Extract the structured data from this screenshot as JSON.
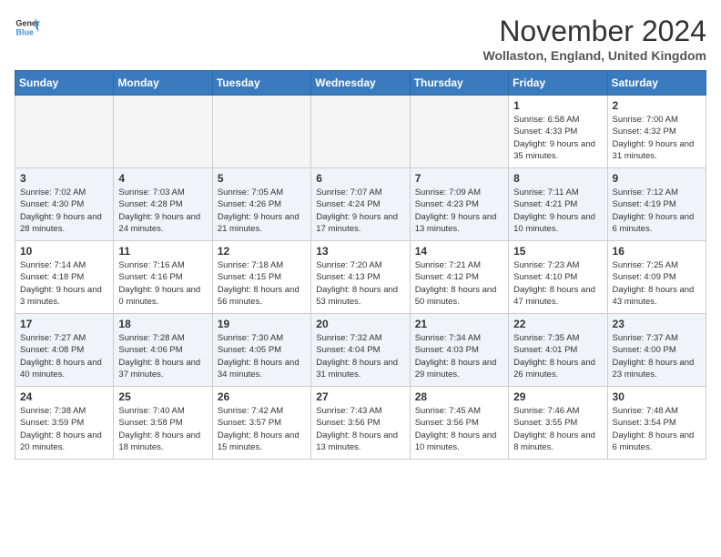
{
  "header": {
    "logo_line1": "General",
    "logo_line2": "Blue",
    "month": "November 2024",
    "location": "Wollaston, England, United Kingdom"
  },
  "weekdays": [
    "Sunday",
    "Monday",
    "Tuesday",
    "Wednesday",
    "Thursday",
    "Friday",
    "Saturday"
  ],
  "weeks": [
    [
      {
        "day": "",
        "info": ""
      },
      {
        "day": "",
        "info": ""
      },
      {
        "day": "",
        "info": ""
      },
      {
        "day": "",
        "info": ""
      },
      {
        "day": "",
        "info": ""
      },
      {
        "day": "1",
        "info": "Sunrise: 6:58 AM\nSunset: 4:33 PM\nDaylight: 9 hours and 35 minutes."
      },
      {
        "day": "2",
        "info": "Sunrise: 7:00 AM\nSunset: 4:32 PM\nDaylight: 9 hours and 31 minutes."
      }
    ],
    [
      {
        "day": "3",
        "info": "Sunrise: 7:02 AM\nSunset: 4:30 PM\nDaylight: 9 hours and 28 minutes."
      },
      {
        "day": "4",
        "info": "Sunrise: 7:03 AM\nSunset: 4:28 PM\nDaylight: 9 hours and 24 minutes."
      },
      {
        "day": "5",
        "info": "Sunrise: 7:05 AM\nSunset: 4:26 PM\nDaylight: 9 hours and 21 minutes."
      },
      {
        "day": "6",
        "info": "Sunrise: 7:07 AM\nSunset: 4:24 PM\nDaylight: 9 hours and 17 minutes."
      },
      {
        "day": "7",
        "info": "Sunrise: 7:09 AM\nSunset: 4:23 PM\nDaylight: 9 hours and 13 minutes."
      },
      {
        "day": "8",
        "info": "Sunrise: 7:11 AM\nSunset: 4:21 PM\nDaylight: 9 hours and 10 minutes."
      },
      {
        "day": "9",
        "info": "Sunrise: 7:12 AM\nSunset: 4:19 PM\nDaylight: 9 hours and 6 minutes."
      }
    ],
    [
      {
        "day": "10",
        "info": "Sunrise: 7:14 AM\nSunset: 4:18 PM\nDaylight: 9 hours and 3 minutes."
      },
      {
        "day": "11",
        "info": "Sunrise: 7:16 AM\nSunset: 4:16 PM\nDaylight: 9 hours and 0 minutes."
      },
      {
        "day": "12",
        "info": "Sunrise: 7:18 AM\nSunset: 4:15 PM\nDaylight: 8 hours and 56 minutes."
      },
      {
        "day": "13",
        "info": "Sunrise: 7:20 AM\nSunset: 4:13 PM\nDaylight: 8 hours and 53 minutes."
      },
      {
        "day": "14",
        "info": "Sunrise: 7:21 AM\nSunset: 4:12 PM\nDaylight: 8 hours and 50 minutes."
      },
      {
        "day": "15",
        "info": "Sunrise: 7:23 AM\nSunset: 4:10 PM\nDaylight: 8 hours and 47 minutes."
      },
      {
        "day": "16",
        "info": "Sunrise: 7:25 AM\nSunset: 4:09 PM\nDaylight: 8 hours and 43 minutes."
      }
    ],
    [
      {
        "day": "17",
        "info": "Sunrise: 7:27 AM\nSunset: 4:08 PM\nDaylight: 8 hours and 40 minutes."
      },
      {
        "day": "18",
        "info": "Sunrise: 7:28 AM\nSunset: 4:06 PM\nDaylight: 8 hours and 37 minutes."
      },
      {
        "day": "19",
        "info": "Sunrise: 7:30 AM\nSunset: 4:05 PM\nDaylight: 8 hours and 34 minutes."
      },
      {
        "day": "20",
        "info": "Sunrise: 7:32 AM\nSunset: 4:04 PM\nDaylight: 8 hours and 31 minutes."
      },
      {
        "day": "21",
        "info": "Sunrise: 7:34 AM\nSunset: 4:03 PM\nDaylight: 8 hours and 29 minutes."
      },
      {
        "day": "22",
        "info": "Sunrise: 7:35 AM\nSunset: 4:01 PM\nDaylight: 8 hours and 26 minutes."
      },
      {
        "day": "23",
        "info": "Sunrise: 7:37 AM\nSunset: 4:00 PM\nDaylight: 8 hours and 23 minutes."
      }
    ],
    [
      {
        "day": "24",
        "info": "Sunrise: 7:38 AM\nSunset: 3:59 PM\nDaylight: 8 hours and 20 minutes."
      },
      {
        "day": "25",
        "info": "Sunrise: 7:40 AM\nSunset: 3:58 PM\nDaylight: 8 hours and 18 minutes."
      },
      {
        "day": "26",
        "info": "Sunrise: 7:42 AM\nSunset: 3:57 PM\nDaylight: 8 hours and 15 minutes."
      },
      {
        "day": "27",
        "info": "Sunrise: 7:43 AM\nSunset: 3:56 PM\nDaylight: 8 hours and 13 minutes."
      },
      {
        "day": "28",
        "info": "Sunrise: 7:45 AM\nSunset: 3:56 PM\nDaylight: 8 hours and 10 minutes."
      },
      {
        "day": "29",
        "info": "Sunrise: 7:46 AM\nSunset: 3:55 PM\nDaylight: 8 hours and 8 minutes."
      },
      {
        "day": "30",
        "info": "Sunrise: 7:48 AM\nSunset: 3:54 PM\nDaylight: 8 hours and 6 minutes."
      }
    ]
  ]
}
